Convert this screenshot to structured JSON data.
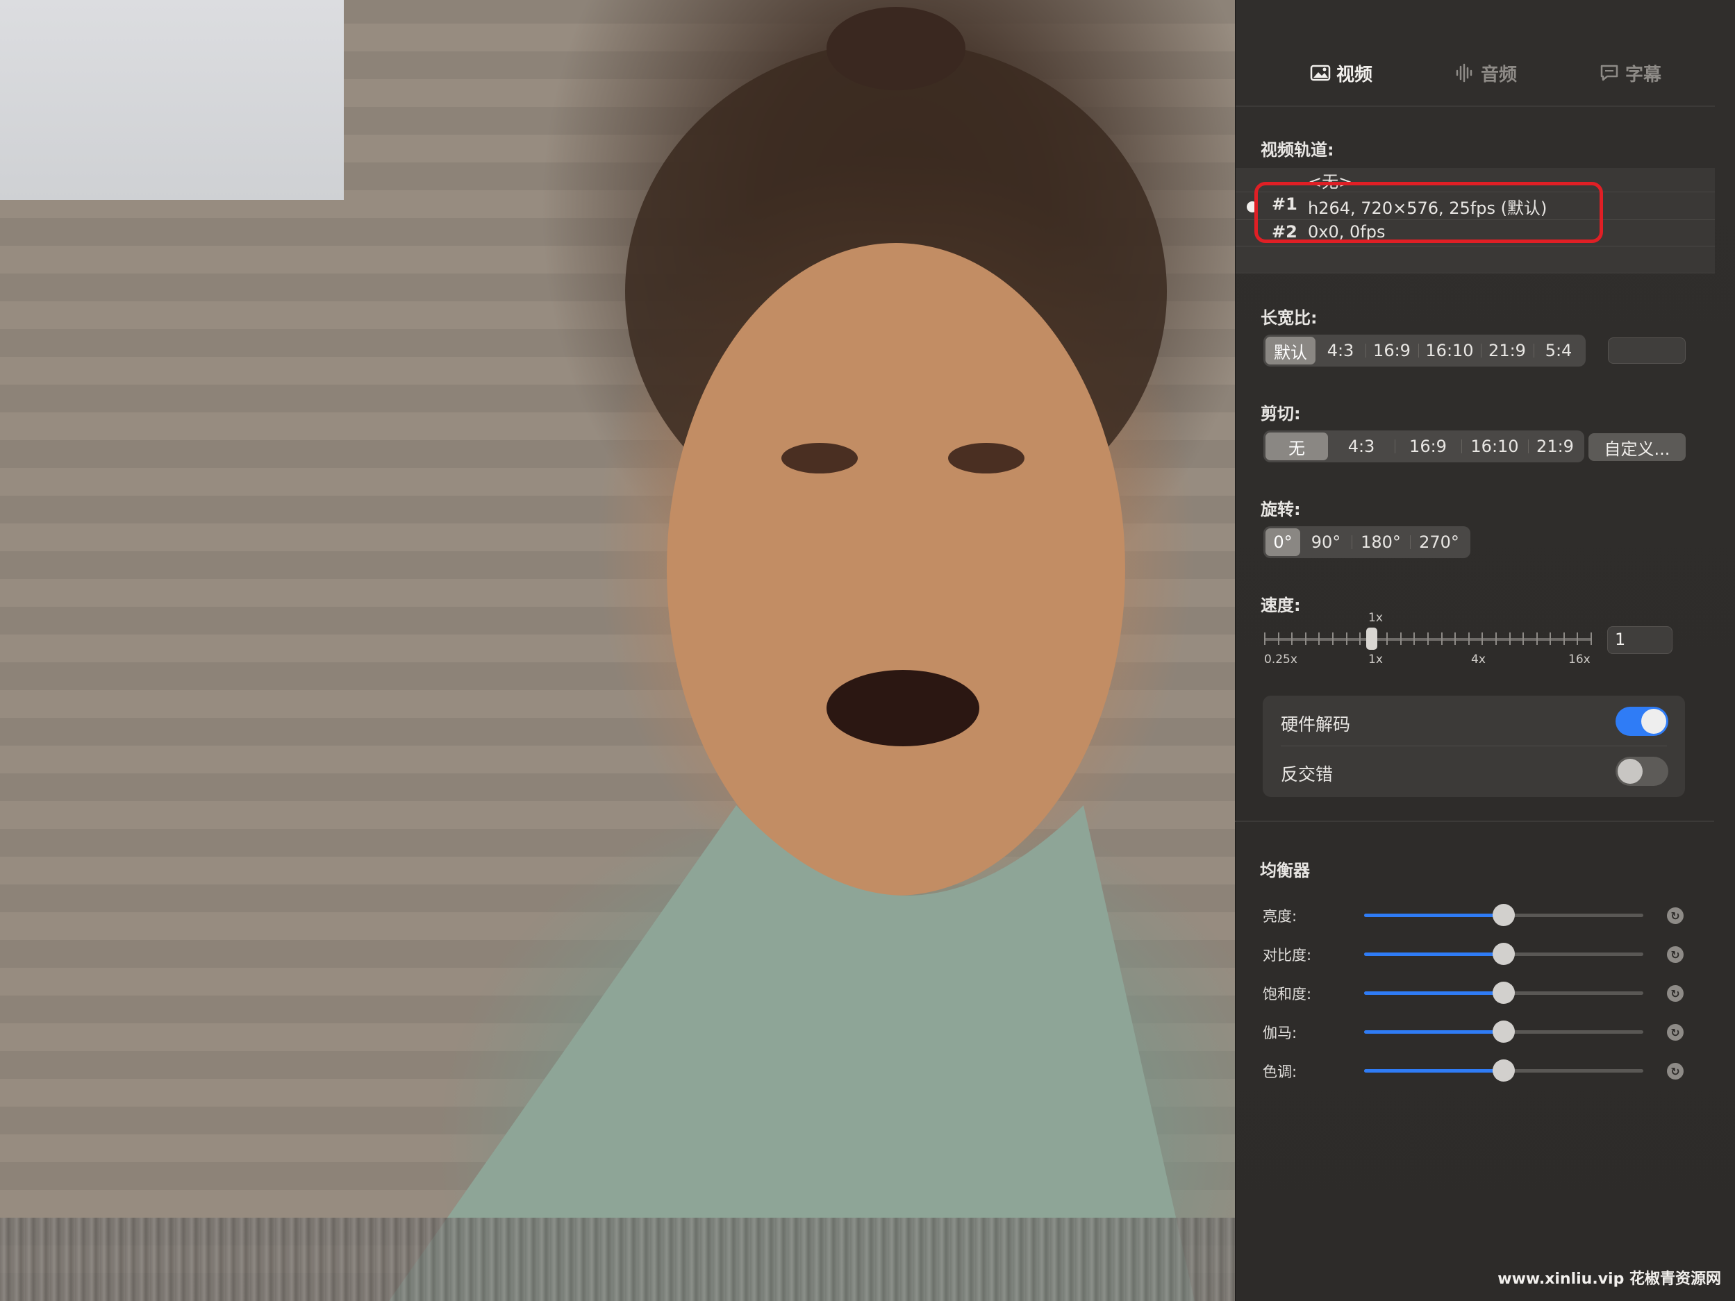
{
  "tabs": [
    {
      "label": "视频",
      "icon": "image-icon",
      "active": true
    },
    {
      "label": "音频",
      "icon": "waveform-icon",
      "active": false
    },
    {
      "label": "字幕",
      "icon": "speech-bubble-icon",
      "active": false
    }
  ],
  "video_track": {
    "title": "视频轨道:",
    "rows": [
      {
        "num": "",
        "desc": "<无>"
      },
      {
        "num": "#1",
        "desc": "h264, 720×576, 25fps (默认)"
      },
      {
        "num": "#2",
        "desc": "0x0, 0fps"
      }
    ]
  },
  "aspect": {
    "title": "长宽比:",
    "options": [
      "默认",
      "4:3",
      "16:9",
      "16:10",
      "21:9",
      "5:4"
    ],
    "selected": "默认",
    "custom_value": ""
  },
  "crop": {
    "title": "剪切:",
    "options": [
      "无",
      "4:3",
      "16:9",
      "16:10",
      "21:9"
    ],
    "selected": "无",
    "custom_label": "自定义..."
  },
  "rotate": {
    "title": "旋转:",
    "options": [
      "0°",
      "90°",
      "180°",
      "270°"
    ],
    "selected": "0°"
  },
  "speed": {
    "title": "速度:",
    "current_label": "1x",
    "scale_labels": [
      "0.25x",
      "1x",
      "4x",
      "16x"
    ],
    "value": "1",
    "position_fraction": 0.33
  },
  "toggles": [
    {
      "label": "硬件解码",
      "on": true
    },
    {
      "label": "反交错",
      "on": false
    }
  ],
  "equalizer": {
    "title": "均衡器",
    "sliders": [
      {
        "label": "亮度:",
        "value": 0.5
      },
      {
        "label": "对比度:",
        "value": 0.5
      },
      {
        "label": "饱和度:",
        "value": 0.5
      },
      {
        "label": "伽马:",
        "value": 0.5
      },
      {
        "label": "色调:",
        "value": 0.5
      }
    ]
  },
  "watermark": "www.xinliu.vip 花椒青资源网",
  "colors": {
    "accent": "#2f7cf6",
    "highlight": "#e01f25"
  }
}
